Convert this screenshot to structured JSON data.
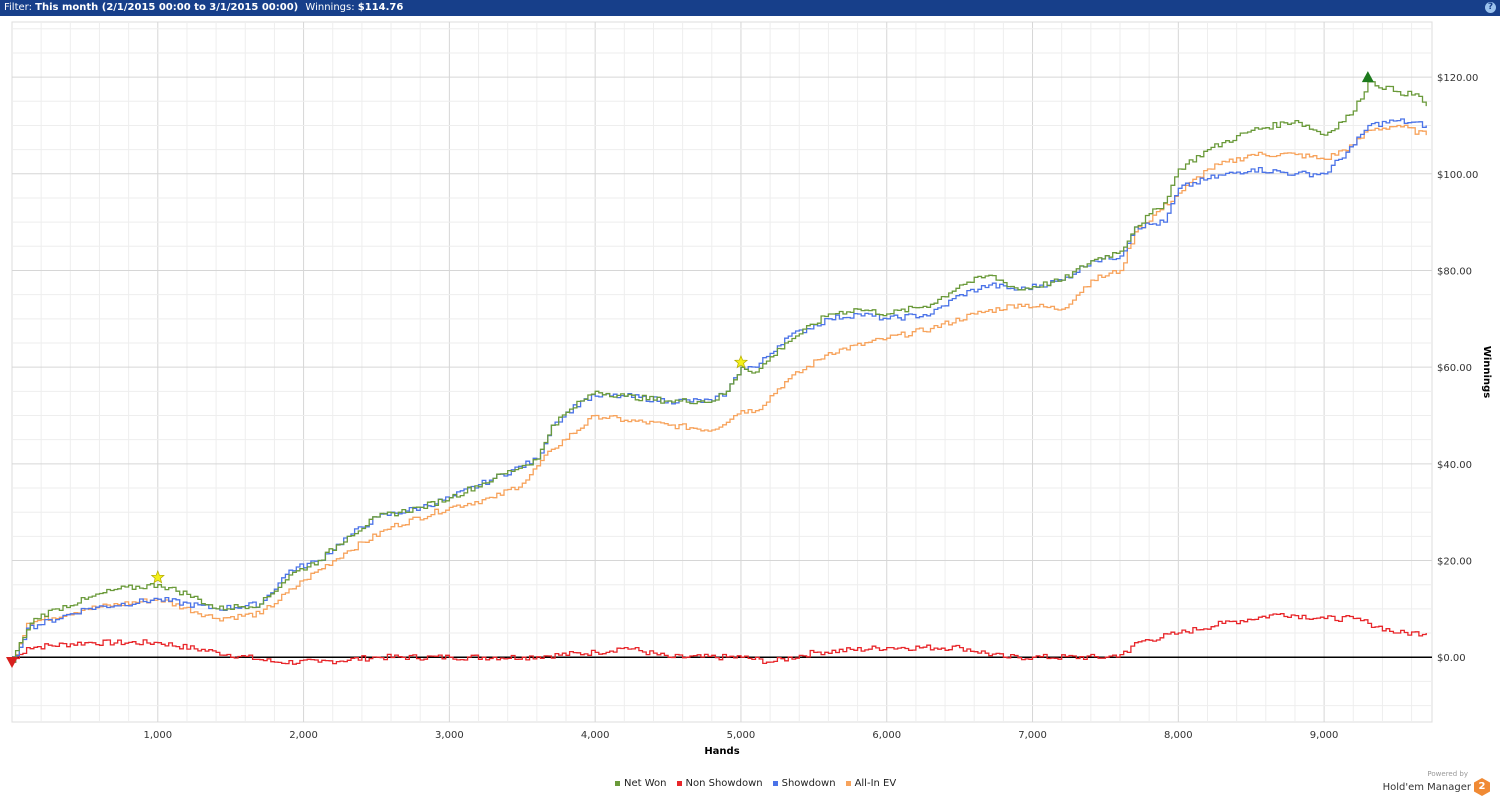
{
  "header": {
    "filter_label": "Filter:",
    "filter_value": "This month (2/1/2015 00:00 to 3/1/2015 00:00)",
    "winnings_label": "Winnings:",
    "winnings_value": "$114.76",
    "help_icon": "?"
  },
  "chart_data": {
    "type": "line",
    "xlabel": "Hands",
    "ylabel": "Winnings",
    "xlim": [
      0,
      9740
    ],
    "ylim": [
      -13.4,
      131.4
    ],
    "x_ticks": [
      1000,
      2000,
      3000,
      4000,
      5000,
      6000,
      7000,
      8000,
      9000
    ],
    "x_tick_labels": [
      "1,000",
      "2,000",
      "3,000",
      "4,000",
      "5,000",
      "6,000",
      "7,000",
      "8,000",
      "9,000"
    ],
    "y_ticks": [
      0,
      20,
      40,
      60,
      80,
      100,
      120
    ],
    "y_tick_labels": [
      "$0.00",
      "$20.00",
      "$40.00",
      "$60.00",
      "$80.00",
      "$100.00",
      "$120.00"
    ],
    "series": [
      {
        "name": "Non Showdown",
        "color": "#e8262a",
        "points": [
          [
            0,
            -1
          ],
          [
            100,
            2
          ],
          [
            500,
            3
          ],
          [
            1000,
            3
          ],
          [
            1400,
            1
          ],
          [
            1800,
            -1
          ],
          [
            2100,
            -1
          ],
          [
            2500,
            0
          ],
          [
            3000,
            0
          ],
          [
            3500,
            0
          ],
          [
            4000,
            1
          ],
          [
            4200,
            2
          ],
          [
            4500,
            0
          ],
          [
            5000,
            0
          ],
          [
            5200,
            -1
          ],
          [
            5500,
            1
          ],
          [
            6000,
            2
          ],
          [
            6500,
            2
          ],
          [
            6800,
            0
          ],
          [
            7000,
            0
          ],
          [
            7500,
            0
          ],
          [
            7650,
            1
          ],
          [
            7700,
            3
          ],
          [
            8000,
            5
          ],
          [
            8300,
            7
          ],
          [
            8700,
            9
          ],
          [
            9000,
            8
          ],
          [
            9200,
            8
          ],
          [
            9300,
            7
          ],
          [
            9500,
            5
          ],
          [
            9700,
            5
          ]
        ]
      },
      {
        "name": "All-In EV",
        "color": "#f7a35c",
        "points": [
          [
            0,
            -1
          ],
          [
            100,
            7
          ],
          [
            500,
            10
          ],
          [
            1000,
            12
          ],
          [
            1400,
            8
          ],
          [
            1700,
            9
          ],
          [
            2000,
            16
          ],
          [
            2300,
            22
          ],
          [
            2600,
            27
          ],
          [
            3000,
            31
          ],
          [
            3300,
            33
          ],
          [
            3500,
            36
          ],
          [
            3700,
            43
          ],
          [
            4000,
            50
          ],
          [
            4200,
            49
          ],
          [
            4500,
            48
          ],
          [
            4800,
            47
          ],
          [
            5000,
            51
          ],
          [
            5100,
            51
          ],
          [
            5300,
            57
          ],
          [
            5600,
            63
          ],
          [
            6000,
            66
          ],
          [
            6300,
            68
          ],
          [
            6600,
            71
          ],
          [
            6900,
            73
          ],
          [
            7200,
            72
          ],
          [
            7400,
            78
          ],
          [
            7600,
            80
          ],
          [
            7700,
            88
          ],
          [
            8000,
            96
          ],
          [
            8200,
            101
          ],
          [
            8500,
            104
          ],
          [
            8800,
            104
          ],
          [
            9000,
            103
          ],
          [
            9200,
            106
          ],
          [
            9300,
            109
          ],
          [
            9500,
            110
          ],
          [
            9700,
            108
          ]
        ]
      },
      {
        "name": "Showdown",
        "color": "#4b73e8",
        "points": [
          [
            0,
            -1
          ],
          [
            100,
            6
          ],
          [
            500,
            10
          ],
          [
            1000,
            12
          ],
          [
            1400,
            10
          ],
          [
            1700,
            11
          ],
          [
            1900,
            18
          ],
          [
            2100,
            20
          ],
          [
            2300,
            25
          ],
          [
            2500,
            29
          ],
          [
            2800,
            31
          ],
          [
            3000,
            33
          ],
          [
            3300,
            37
          ],
          [
            3600,
            41
          ],
          [
            3700,
            48
          ],
          [
            3900,
            53
          ],
          [
            4000,
            54
          ],
          [
            4200,
            54
          ],
          [
            4500,
            53
          ],
          [
            4800,
            53
          ],
          [
            4900,
            55
          ],
          [
            5000,
            60
          ],
          [
            5100,
            60
          ],
          [
            5300,
            66
          ],
          [
            5600,
            70
          ],
          [
            5800,
            71
          ],
          [
            6000,
            70
          ],
          [
            6300,
            71
          ],
          [
            6500,
            75
          ],
          [
            6700,
            77
          ],
          [
            6900,
            76
          ],
          [
            7200,
            78
          ],
          [
            7400,
            82
          ],
          [
            7600,
            83
          ],
          [
            7700,
            89
          ],
          [
            7900,
            90
          ],
          [
            8000,
            97
          ],
          [
            8200,
            99
          ],
          [
            8500,
            101
          ],
          [
            8800,
            100
          ],
          [
            9000,
            100
          ],
          [
            9200,
            106
          ],
          [
            9300,
            110
          ],
          [
            9500,
            111
          ],
          [
            9700,
            110
          ]
        ]
      },
      {
        "name": "Net Won",
        "color": "#6a9a3a",
        "points": [
          [
            0,
            -1
          ],
          [
            50,
            3
          ],
          [
            150,
            8
          ],
          [
            300,
            10
          ],
          [
            500,
            12
          ],
          [
            700,
            14
          ],
          [
            1000,
            15
          ],
          [
            1200,
            13
          ],
          [
            1400,
            10
          ],
          [
            1700,
            11
          ],
          [
            1900,
            17
          ],
          [
            2100,
            20
          ],
          [
            2300,
            25
          ],
          [
            2500,
            29
          ],
          [
            2800,
            31
          ],
          [
            3000,
            33
          ],
          [
            3300,
            37
          ],
          [
            3600,
            41
          ],
          [
            3700,
            48
          ],
          [
            3900,
            53
          ],
          [
            4000,
            55
          ],
          [
            4200,
            54
          ],
          [
            4500,
            53
          ],
          [
            4800,
            53
          ],
          [
            4900,
            55
          ],
          [
            5000,
            60
          ],
          [
            5100,
            59
          ],
          [
            5300,
            65
          ],
          [
            5600,
            71
          ],
          [
            5800,
            72
          ],
          [
            6000,
            71
          ],
          [
            6300,
            73
          ],
          [
            6500,
            77
          ],
          [
            6700,
            79
          ],
          [
            6900,
            76
          ],
          [
            7200,
            78
          ],
          [
            7400,
            82
          ],
          [
            7600,
            84
          ],
          [
            7700,
            89
          ],
          [
            7900,
            94
          ],
          [
            8000,
            101
          ],
          [
            8200,
            105
          ],
          [
            8500,
            109
          ],
          [
            8800,
            111
          ],
          [
            9000,
            108
          ],
          [
            9200,
            113
          ],
          [
            9300,
            119
          ],
          [
            9500,
            117
          ],
          [
            9650,
            116
          ],
          [
            9700,
            114
          ]
        ]
      }
    ],
    "markers": [
      {
        "type": "min",
        "shape": "triangle-down",
        "color": "#d8201e",
        "x": 0,
        "y": -1
      },
      {
        "type": "star",
        "shape": "star",
        "color": "#f4f01a",
        "x": 1000,
        "y": 16.5
      },
      {
        "type": "star",
        "shape": "star",
        "color": "#f4f01a",
        "x": 5000,
        "y": 61
      },
      {
        "type": "max",
        "shape": "triangle-up",
        "color": "#1c7a1c",
        "x": 9300,
        "y": 120
      }
    ],
    "legend_position": "bottom"
  },
  "legend": [
    {
      "label": "Net Won",
      "color": "#6a9a3a"
    },
    {
      "label": "Non Showdown",
      "color": "#e8262a"
    },
    {
      "label": "Showdown",
      "color": "#4b73e8"
    },
    {
      "label": "All-In EV",
      "color": "#f7a35c"
    }
  ],
  "brand": {
    "powered": "Powered by",
    "name": "Hold'em Manager",
    "logo": "2"
  }
}
